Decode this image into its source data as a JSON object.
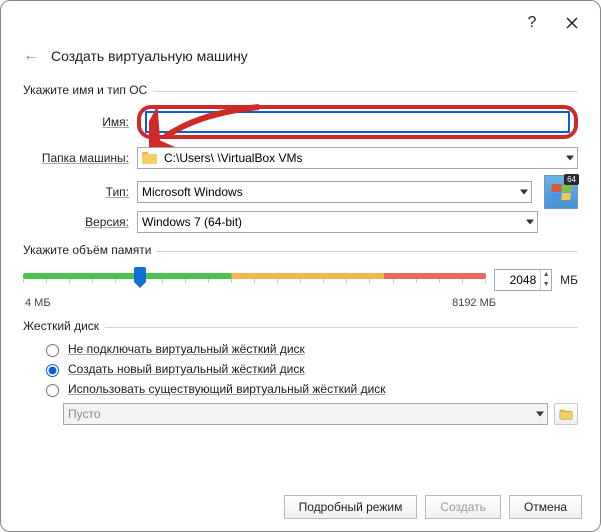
{
  "titlebar": {
    "help_glyph": "?",
    "close_glyph": "✕"
  },
  "header": {
    "back_glyph": "←",
    "title": "Создать виртуальную машину"
  },
  "group_name": {
    "title": "Укажите имя и тип ОС",
    "name_label": "Имя:",
    "name_value": "",
    "folder_label": "Папка машины:",
    "folder_value": "C:\\Users\\            \\VirtualBox VMs",
    "type_label": "Тип:",
    "type_value": "Microsoft Windows",
    "version_label": "Версия:",
    "version_value": "Windows 7 (64-bit)",
    "badge64": "64"
  },
  "group_mem": {
    "title": "Укажите объём памяти",
    "value": "2048",
    "unit": "МБ",
    "min": "4 МБ",
    "max": "8192 МБ"
  },
  "group_disk": {
    "title": "Жесткий диск",
    "opt_none": "Не подключать виртуальный жёсткий диск",
    "opt_new": "Создать новый виртуальный жёсткий диск",
    "opt_existing": "Использовать существующий виртуальный жёсткий диск",
    "existing_value": "Пусто",
    "selected": "new"
  },
  "footer": {
    "expert": "Подробный режим",
    "create": "Создать",
    "cancel": "Отмена"
  },
  "colors": {
    "accent": "#0a5cd8",
    "highlight": "#cf2a27"
  }
}
